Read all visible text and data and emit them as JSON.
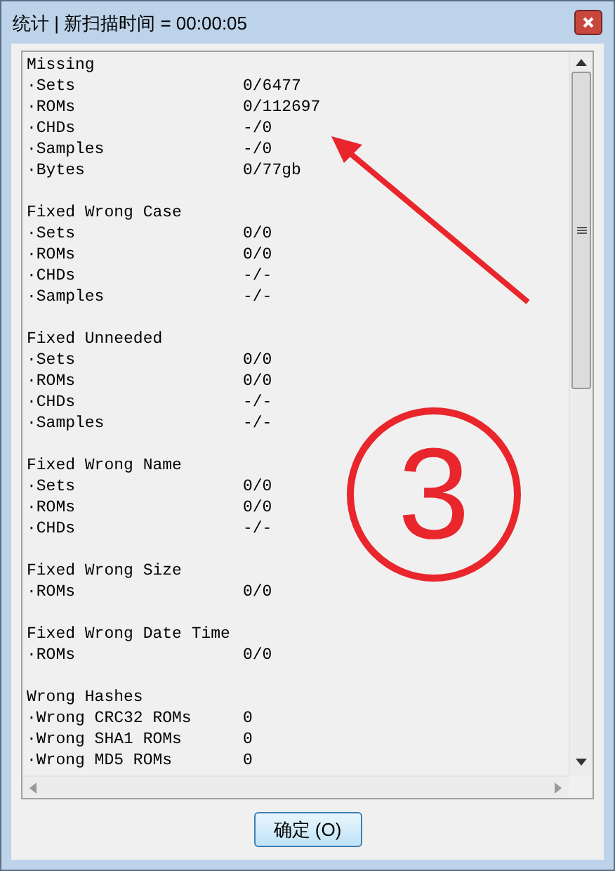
{
  "window": {
    "title": "统计 | 新扫描时间 = 00:00:05"
  },
  "sections": [
    {
      "title": "Missing",
      "rows": [
        {
          "label": "·Sets",
          "value": "0/6477"
        },
        {
          "label": "·ROMs",
          "value": "0/112697"
        },
        {
          "label": "·CHDs",
          "value": "-/0"
        },
        {
          "label": "·Samples",
          "value": "-/0"
        },
        {
          "label": "·Bytes",
          "value": "0/77gb"
        }
      ]
    },
    {
      "title": "Fixed Wrong Case",
      "rows": [
        {
          "label": "·Sets",
          "value": "0/0"
        },
        {
          "label": "·ROMs",
          "value": "0/0"
        },
        {
          "label": "·CHDs",
          "value": "-/-"
        },
        {
          "label": "·Samples",
          "value": "-/-"
        }
      ]
    },
    {
      "title": "Fixed Unneeded",
      "rows": [
        {
          "label": "·Sets",
          "value": "0/0"
        },
        {
          "label": "·ROMs",
          "value": "0/0"
        },
        {
          "label": "·CHDs",
          "value": "-/-"
        },
        {
          "label": "·Samples",
          "value": "-/-"
        }
      ]
    },
    {
      "title": "Fixed Wrong Name",
      "rows": [
        {
          "label": "·Sets",
          "value": "0/0"
        },
        {
          "label": "·ROMs",
          "value": "0/0"
        },
        {
          "label": "·CHDs",
          "value": "-/-"
        }
      ]
    },
    {
      "title": "Fixed Wrong Size",
      "rows": [
        {
          "label": "·ROMs",
          "value": "0/0"
        }
      ]
    },
    {
      "title": "Fixed Wrong Date Time",
      "rows": [
        {
          "label": "·ROMs",
          "value": "0/0"
        }
      ]
    },
    {
      "title": "Wrong Hashes",
      "rows": [
        {
          "label": "·Wrong CRC32 ROMs",
          "value": "0"
        },
        {
          "label": "·Wrong SHA1 ROMs",
          "value": "0"
        },
        {
          "label": "·Wrong MD5 ROMs",
          "value": "0"
        }
      ]
    }
  ],
  "annotation": {
    "label": "3"
  },
  "buttons": [
    "确定 (O)"
  ]
}
